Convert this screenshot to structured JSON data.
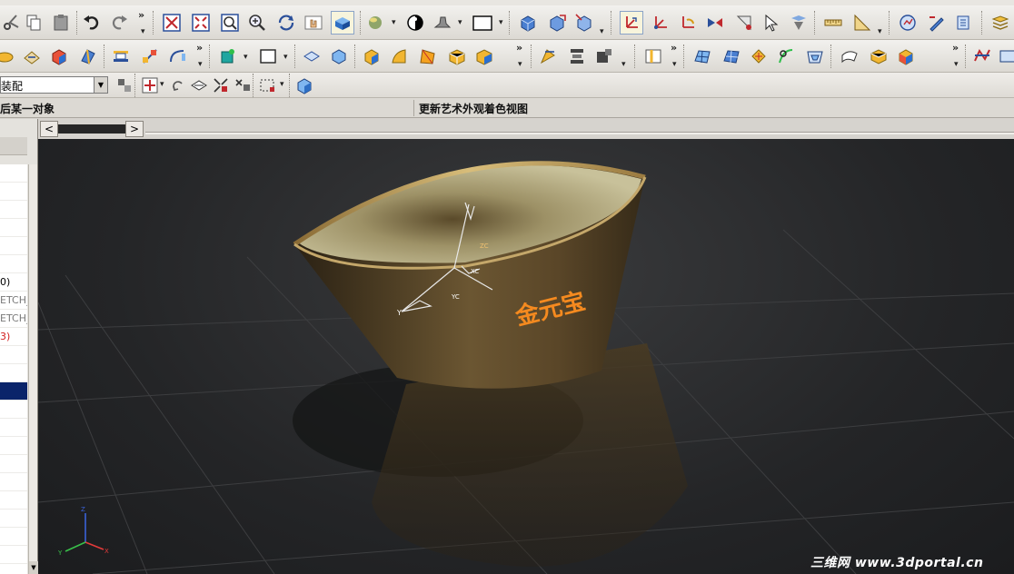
{
  "toolbar": {
    "assembly_combo": {
      "value": "装配"
    }
  },
  "cue_line": {
    "left_text": "后某一对象",
    "right_text": "更新艺术外观着色视图"
  },
  "navigator": {
    "rows": [
      {
        "label": "",
        "color": "#000000"
      },
      {
        "label": "",
        "color": "#000000"
      },
      {
        "label": "",
        "color": "#000000"
      },
      {
        "label": "",
        "color": "#000000"
      },
      {
        "label": "",
        "color": "#000000"
      },
      {
        "label": "",
        "color": "#000000"
      },
      {
        "label": "0)",
        "color": "#000000"
      },
      {
        "label": "ETCH_",
        "color": "#7a7a7a"
      },
      {
        "label": "ETCH_",
        "color": "#7a7a7a"
      },
      {
        "label": "3)",
        "color": "#d21e1e"
      },
      {
        "label": "",
        "color": "#000000"
      },
      {
        "label": "",
        "color": "#000000"
      },
      {
        "label": "",
        "color": "#000000",
        "selected": true
      },
      {
        "label": "",
        "color": "#000000"
      },
      {
        "label": "",
        "color": "#000000"
      },
      {
        "label": "",
        "color": "#000000"
      },
      {
        "label": "",
        "color": "#000000"
      },
      {
        "label": "",
        "color": "#000000"
      },
      {
        "label": "",
        "color": "#000000"
      },
      {
        "label": "",
        "color": "#000000"
      },
      {
        "label": "",
        "color": "#000000"
      },
      {
        "label": "",
        "color": "#000000"
      }
    ]
  },
  "viewport_tabs": {
    "left_arrow": "<",
    "right_arrow": ">"
  },
  "viewport": {
    "bowl_text": "金元宝",
    "bowl_text_color": "#f58a1f",
    "triad_labels": {
      "x": "X",
      "y": "Y",
      "z": "Z",
      "xc": "XC",
      "yc": "YC",
      "zc": "ZC"
    },
    "watermark": "三维网 www.3dportal.cn"
  },
  "colors": {
    "selection": "#0a246a",
    "viewport_bg": "#242527",
    "bowl_outer": "#4a3b22",
    "bowl_rim": "#b89d5a"
  },
  "icons": {
    "row1": [
      "scissors-icon",
      "copy-icon",
      "paste-icon",
      "undo-icon",
      "redo-icon",
      "fit-icon",
      "zoom-window-icon",
      "zoom-icon",
      "zoom-in-icon",
      "rotate-icon",
      "pan-icon",
      "shaded-view-icon",
      "render-icon",
      "color-wheel-icon",
      "hat-icon",
      "background-icon",
      "wcs-icon",
      "wcs-origin-icon",
      "wcs-rotate-icon",
      "snap-icon",
      "point-icon",
      "select-icon",
      "selection-filter-icon",
      "measure-distance-icon",
      "measure-angle-icon",
      "analysis-icon",
      "draw-icon",
      "edit-icon",
      "layers-icon"
    ],
    "row2": [
      "sketch-icon",
      "extrude-icon",
      "revolve-icon",
      "sweep-icon",
      "datum-plane-icon",
      "datum-axis-icon",
      "curve-icon",
      "point-set-icon",
      "rectangle-icon",
      "box-icon",
      "sphere-icon",
      "cylinder-icon",
      "cone-icon",
      "surface-icon",
      "block-icon",
      "hole-icon",
      "pattern-icon",
      "mirror-icon",
      "blend-icon",
      "chamfer-icon",
      "trim-icon",
      "thicken-icon",
      "ruled-icon",
      "through-curves-icon",
      "mesh-icon",
      "offset-icon",
      "studio-icon",
      "fill-icon",
      "analyze-icon"
    ],
    "row3": [
      "assembly-add-icon",
      "constraint-icon",
      "reposition-icon",
      "mate-icon",
      "explode-icon",
      "bbox-icon",
      "component-icon"
    ]
  }
}
